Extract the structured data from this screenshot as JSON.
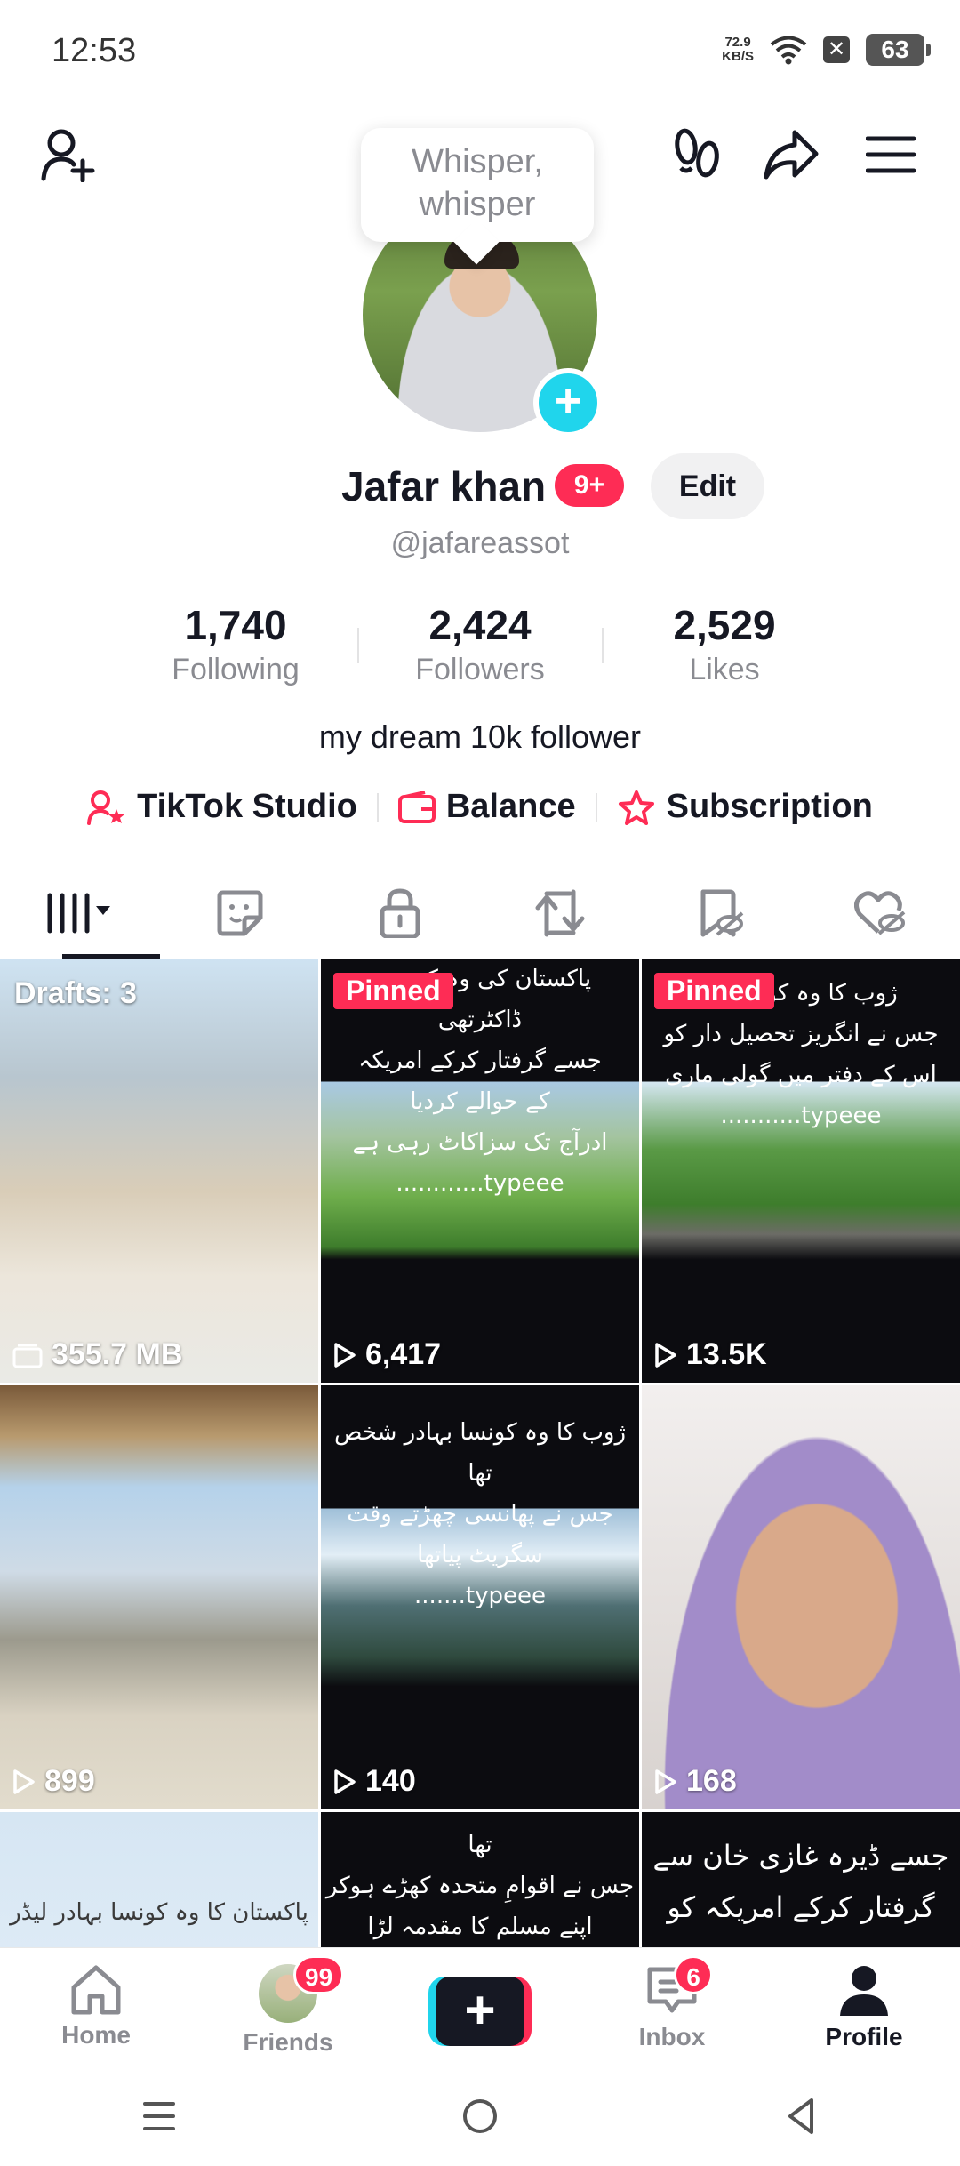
{
  "status_bar": {
    "time": "12:53",
    "net_speed_top": "72.9",
    "net_speed_bottom": "KB/S",
    "battery": "63"
  },
  "whisper": {
    "line1": "Whisper,",
    "line2": "whisper"
  },
  "profile": {
    "name": "Jafar khan",
    "notification_badge": "9+",
    "edit_label": "Edit",
    "handle": "@jafareassot",
    "bio": "my dream 10k follower"
  },
  "stats": [
    {
      "value": "1,740",
      "label": "Following"
    },
    {
      "value": "2,424",
      "label": "Followers"
    },
    {
      "value": "2,529",
      "label": "Likes"
    }
  ],
  "links": {
    "studio": "TikTok Studio",
    "balance": "Balance",
    "subscription": "Subscription"
  },
  "tabs": [
    "videos-icon",
    "sticker-icon",
    "lock-icon",
    "repost-icon",
    "favorites-icon",
    "liked-icon"
  ],
  "grid": {
    "drafts_label": "Drafts: 3",
    "draft_size": "355.7 MB",
    "pinned_label": "Pinned",
    "views": [
      "6,417",
      "13.5K",
      "899",
      "140",
      "168"
    ],
    "urdu": {
      "c2_lines": [
        "پاکستان کی وہ کونسی",
        "ڈاکٹرتھی",
        "جسے گرفتار کرکے امریکہ",
        "کے حوالے کردیا",
        "ادرآج تک سزاکاٹ رہی ہے",
        "typeee............"
      ],
      "c3_lines": [
        "ژوب کا وہ کونسا بہ",
        "جس نے انگریز تحصیل دار کو",
        "اس کے دفتر میں گولی ماری",
        "typeee..........."
      ],
      "c5_lines": [
        "ژوب کا وہ کونسا بہادر شخص تھا",
        "جس نے پھانسی چھڑتے وقت",
        "سگریٹ پیاتھا",
        "typeee......."
      ],
      "c7_lines": [
        "پاکستان کا وہ کونسا بہادر لیڈر ہے"
      ],
      "c8_lines": [
        "تھا",
        "جس نے اقوامِ متحدہ کھڑے ہوکر",
        "اپنے مسلم کا مقدمہ لڑا"
      ],
      "c9_lines": [
        "جسے ڈیرہ غازی خان سے",
        "گرفتار کرکے امریکہ کو"
      ]
    }
  },
  "bottom_nav": {
    "home": "Home",
    "friends": "Friends",
    "friends_badge": "99",
    "inbox": "Inbox",
    "inbox_badge": "6",
    "profile": "Profile"
  },
  "colors": {
    "accent_red": "#fe2c55",
    "accent_cyan": "#20d5ec",
    "text_primary": "#161823",
    "text_secondary": "#8a8b91"
  }
}
